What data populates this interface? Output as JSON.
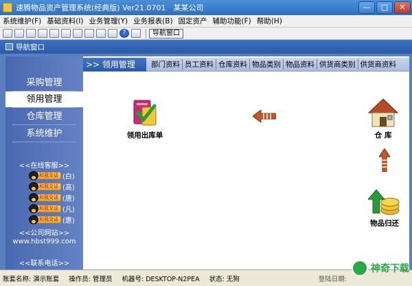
{
  "window": {
    "title": "速腾物品资产管理系统(经典版) Ver21.0701　某某公司",
    "minimize": "—",
    "maximize": "□",
    "close": "✕"
  },
  "menu": [
    "系统维护(F)",
    "基础资料(I)",
    "业务管理(Y)",
    "业务报表(B)",
    "固定资产",
    "辅助功能(F)",
    "帮助(H)"
  ],
  "toolbar": {
    "help": "?",
    "nav_button": "导航窗口"
  },
  "nav_panel": {
    "title": "导航窗口"
  },
  "sidebar": {
    "items": [
      "采购管理",
      "领用管理",
      "仓库管理",
      "系统维护"
    ],
    "active_index": 1,
    "online_service_title": "<<在线客服>>",
    "qq_badge": "和我交谈",
    "qq_contacts": [
      "(白)",
      "(高)",
      "(唐)",
      "(凡)",
      "(惠)"
    ],
    "website_title": "<<公司网站>>",
    "website": "www.hbst999.com",
    "phone_title": "<<联系电话>>"
  },
  "tabs": {
    "current": ">> 领用管理",
    "links": [
      "部门资料",
      "员工资料",
      "仓库资料",
      "物品类别",
      "物品资料",
      "供货商类别",
      "供货商资料"
    ]
  },
  "modules": {
    "issue": "领用出库单",
    "warehouse": "仓 库",
    "return": "物品归还"
  },
  "status": {
    "account": "账套名称: 演示账套",
    "operator": "操作员: 管理员",
    "machine": "机器号: DESKTOP-N2PEA",
    "state": "状态: 无狗",
    "date": "登陆日期:"
  },
  "watermark": "神奇下载"
}
